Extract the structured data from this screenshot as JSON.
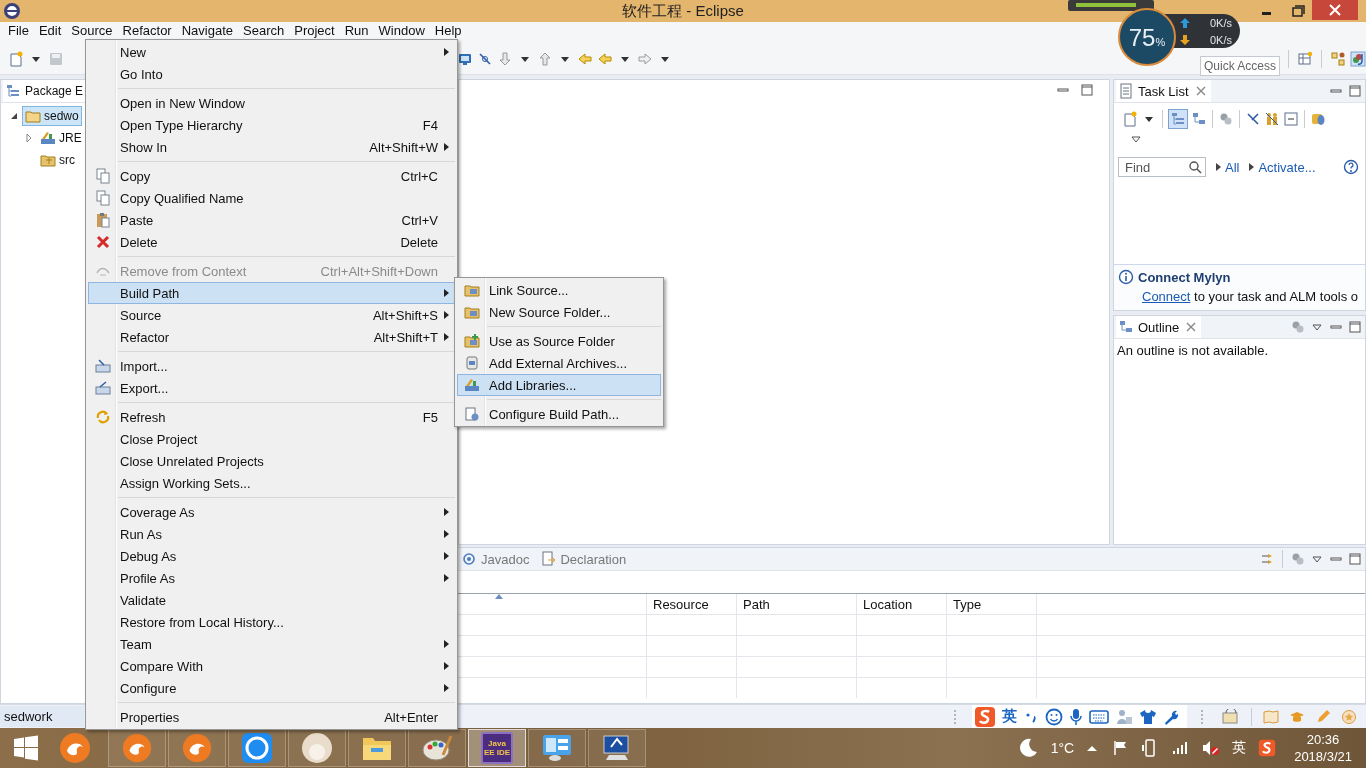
{
  "window": {
    "title": "软件工程 - Eclipse"
  },
  "menubar": [
    "File",
    "Edit",
    "Source",
    "Refactor",
    "Navigate",
    "Search",
    "Project",
    "Run",
    "Window",
    "Help"
  ],
  "toolbar": {
    "quick_access": {
      "placeholder": "Quick Access"
    }
  },
  "package_explorer": {
    "tab": "Package E",
    "tree": [
      {
        "label": "sedwo",
        "expanded": true,
        "selected": true,
        "children": [
          {
            "label": "JRE",
            "expanded": false,
            "selected": false
          },
          {
            "label": "src",
            "selected": false
          }
        ]
      }
    ]
  },
  "context_menu": {
    "items": [
      {
        "kind": "item",
        "label": "New",
        "submenu": true,
        "disabled": false,
        "selected": false
      },
      {
        "kind": "item",
        "label": "Go Into",
        "disabled": false,
        "selected": false
      },
      {
        "kind": "separator"
      },
      {
        "kind": "item",
        "label": "Open in New Window",
        "disabled": false,
        "selected": false
      },
      {
        "kind": "item",
        "label": "Open Type Hierarchy",
        "shortcut": "F4",
        "disabled": false,
        "selected": false
      },
      {
        "kind": "item",
        "label": "Show In",
        "shortcut": "Alt+Shift+W",
        "submenu": true,
        "disabled": false,
        "selected": false
      },
      {
        "kind": "separator"
      },
      {
        "kind": "item",
        "label": "Copy",
        "shortcut": "Ctrl+C",
        "disabled": false,
        "selected": false
      },
      {
        "kind": "item",
        "label": "Copy Qualified Name",
        "disabled": false,
        "selected": false
      },
      {
        "kind": "item",
        "label": "Paste",
        "shortcut": "Ctrl+V",
        "disabled": false,
        "selected": false
      },
      {
        "kind": "item",
        "label": "Delete",
        "shortcut": "Delete",
        "disabled": false,
        "selected": false
      },
      {
        "kind": "separator"
      },
      {
        "kind": "item",
        "label": "Remove from Context",
        "shortcut": "Ctrl+Alt+Shift+Down",
        "disabled": true,
        "selected": false
      },
      {
        "kind": "item",
        "label": "Build Path",
        "submenu": true,
        "disabled": false,
        "selected": true
      },
      {
        "kind": "item",
        "label": "Source",
        "shortcut": "Alt+Shift+S",
        "submenu": true,
        "disabled": false,
        "selected": false
      },
      {
        "kind": "item",
        "label": "Refactor",
        "shortcut": "Alt+Shift+T",
        "submenu": true,
        "disabled": false,
        "selected": false
      },
      {
        "kind": "separator"
      },
      {
        "kind": "item",
        "label": "Import...",
        "disabled": false,
        "selected": false
      },
      {
        "kind": "item",
        "label": "Export...",
        "disabled": false,
        "selected": false
      },
      {
        "kind": "separator"
      },
      {
        "kind": "item",
        "label": "Refresh",
        "shortcut": "F5",
        "disabled": false,
        "selected": false
      },
      {
        "kind": "item",
        "label": "Close Project",
        "disabled": false,
        "selected": false
      },
      {
        "kind": "item",
        "label": "Close Unrelated Projects",
        "disabled": false,
        "selected": false
      },
      {
        "kind": "item",
        "label": "Assign Working Sets...",
        "disabled": false,
        "selected": false
      },
      {
        "kind": "separator"
      },
      {
        "kind": "item",
        "label": "Coverage As",
        "submenu": true,
        "disabled": false,
        "selected": false
      },
      {
        "kind": "item",
        "label": "Run As",
        "submenu": true,
        "disabled": false,
        "selected": false
      },
      {
        "kind": "item",
        "label": "Debug As",
        "submenu": true,
        "disabled": false,
        "selected": false
      },
      {
        "kind": "item",
        "label": "Profile As",
        "submenu": true,
        "disabled": false,
        "selected": false
      },
      {
        "kind": "item",
        "label": "Validate",
        "disabled": false,
        "selected": false
      },
      {
        "kind": "item",
        "label": "Restore from Local History...",
        "disabled": false,
        "selected": false
      },
      {
        "kind": "item",
        "label": "Team",
        "submenu": true,
        "disabled": false,
        "selected": false
      },
      {
        "kind": "item",
        "label": "Compare With",
        "submenu": true,
        "disabled": false,
        "selected": false
      },
      {
        "kind": "item",
        "label": "Configure",
        "submenu": true,
        "disabled": false,
        "selected": false
      },
      {
        "kind": "separator"
      },
      {
        "kind": "item",
        "label": "Properties",
        "shortcut": "Alt+Enter",
        "disabled": false,
        "selected": false
      }
    ]
  },
  "submenu": {
    "items": [
      {
        "kind": "item",
        "label": "Link Source...",
        "selected": false
      },
      {
        "kind": "item",
        "label": "New Source Folder...",
        "selected": false
      },
      {
        "kind": "separator"
      },
      {
        "kind": "item",
        "label": "Use as Source Folder",
        "selected": false
      },
      {
        "kind": "item",
        "label": "Add External Archives...",
        "selected": false
      },
      {
        "kind": "item",
        "label": "Add Libraries...",
        "selected": true
      },
      {
        "kind": "separator"
      },
      {
        "kind": "item",
        "label": "Configure Build Path...",
        "selected": false
      }
    ]
  },
  "task_list": {
    "title": "Task List",
    "find": {
      "placeholder": "Find"
    },
    "links": [
      "All",
      "Activate..."
    ]
  },
  "mylyn": {
    "title": "Connect Mylyn",
    "link": "Connect",
    "text": "to your task and ALM tools o"
  },
  "outline": {
    "title": "Outline",
    "message": "An outline is not available."
  },
  "bottom_panel": {
    "tabs": [
      "Javadoc",
      "Declaration"
    ],
    "columns": [
      "Resource",
      "Path",
      "Location",
      "Type"
    ]
  },
  "status_bar": {
    "text": "sedwork",
    "ime_mode": "英"
  },
  "widget": {
    "percent": "75",
    "unit": "%",
    "upload": "0K/s",
    "download": "0K/s"
  },
  "taskbar": {
    "apps": [
      {
        "kind": "fox",
        "selected": false
      },
      {
        "kind": "fox",
        "selected": false
      },
      {
        "kind": "player",
        "selected": false
      },
      {
        "kind": "avatar",
        "selected": false
      },
      {
        "kind": "folder",
        "selected": false
      },
      {
        "kind": "palette",
        "selected": false
      },
      {
        "kind": "ide",
        "label": "Java EE IDE",
        "selected": true
      },
      {
        "kind": "panel",
        "selected": false
      },
      {
        "kind": "monitor",
        "selected": false
      }
    ]
  },
  "tray": {
    "weather": "1°C",
    "ime": "英",
    "time": "20:36",
    "date": "2018/3/21"
  }
}
